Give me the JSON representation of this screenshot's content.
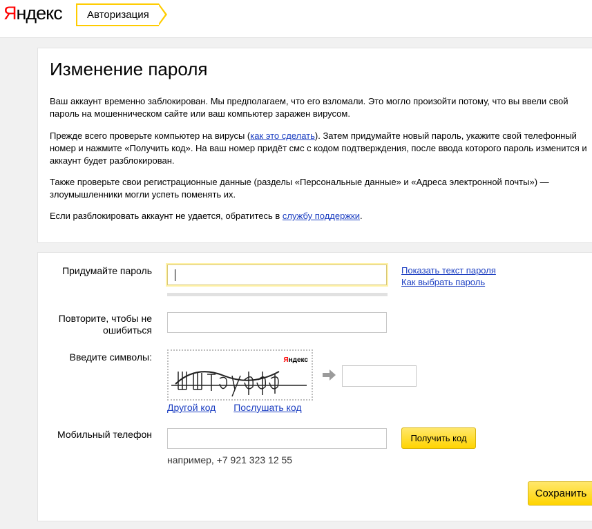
{
  "header": {
    "logo_first": "Я",
    "logo_rest": "ндекс",
    "service": "Авторизация"
  },
  "info": {
    "title": "Изменение пароля",
    "p1": "Ваш аккаунт временно заблокирован. Мы предполагаем, что его взломали. Это могло произойти потому, что вы ввели свой пароль на мошенническом сайте или ваш компьютер заражен вирусом.",
    "p2_before": "Прежде всего проверьте компьютер на вирусы (",
    "p2_link": "как это сделать",
    "p2_after": "). Затем придумайте новый пароль, укажите свой телефонный номер и нажмите «Получить код». На ваш номер придёт смс с кодом подтверждения, после ввода которого пароль изменится и аккаунт будет разблокирован.",
    "p3": "Также проверьте свои регистрационные данные (разделы «Персональные данные» и «Адреса электронной почты») — злоумышленники могли успеть поменять их.",
    "p4_before": "Если разблокировать аккаунт не удается, обратитесь в ",
    "p4_link": "службу поддержки",
    "p4_after": "."
  },
  "form": {
    "password_label": "Придумайте пароль",
    "password_value": "",
    "show_password_link": "Показать текст пароля",
    "choose_password_link": "Как выбрать пароль",
    "repeat_label": "Повторите, чтобы не ошибиться",
    "repeat_value": "",
    "captcha_label": "Введите символы:",
    "captcha_brand_first": "Я",
    "captcha_brand_rest": "ндекс",
    "captcha_value": "",
    "other_code_link": "Другой код",
    "listen_code_link": "Послушать код",
    "phone_label": "Мобильный телефон",
    "phone_value": "",
    "phone_hint": "например, +7 921 323 12 55",
    "get_code_button": "Получить код",
    "save_button": "Сохранить"
  },
  "colors": {
    "accent_yellow": "#ffd400",
    "link_blue": "#1a3dc1",
    "logo_red": "#ff0000"
  }
}
